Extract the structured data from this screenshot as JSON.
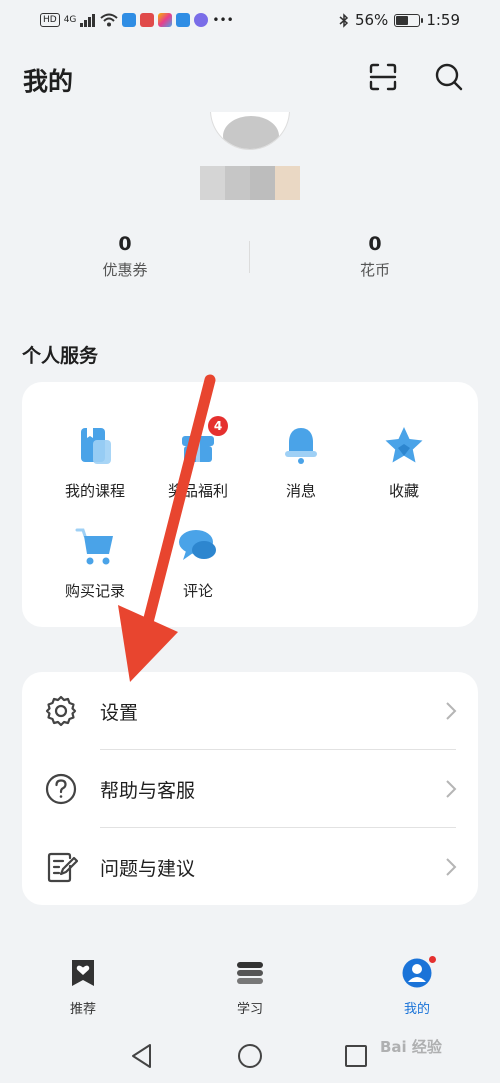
{
  "status_bar": {
    "left_icons": [
      "hd-icon",
      "signal-icon",
      "wifi-icon",
      "cloud-icon",
      "app-icon",
      "app-icon",
      "cloud-icon",
      "music-icon",
      "more-icon"
    ],
    "hd": "HD",
    "net": "4G",
    "battery_percent_text": "56%",
    "battery_level": 0.56,
    "time": "1:59"
  },
  "header": {
    "title": "我的",
    "scan_icon": "scan-icon",
    "search_icon": "search-icon"
  },
  "stats": [
    {
      "value": "0",
      "label": "优惠券"
    },
    {
      "value": "0",
      "label": "花币"
    }
  ],
  "services": {
    "title": "个人服务",
    "items": [
      {
        "label": "我的课程",
        "icon": "book-icon",
        "badge": ""
      },
      {
        "label": "奖品福利",
        "icon": "gift-icon",
        "badge": "4"
      },
      {
        "label": "消息",
        "icon": "bell-icon",
        "badge": ""
      },
      {
        "label": "收藏",
        "icon": "star-icon",
        "badge": ""
      },
      {
        "label": "购买记录",
        "icon": "cart-icon",
        "badge": ""
      },
      {
        "label": "评论",
        "icon": "comment-icon",
        "badge": ""
      }
    ]
  },
  "menu": [
    {
      "label": "设置",
      "icon": "gear-icon"
    },
    {
      "label": "帮助与客服",
      "icon": "help-icon"
    },
    {
      "label": "问题与建议",
      "icon": "feedback-icon"
    }
  ],
  "bottom_nav": [
    {
      "label": "推荐",
      "icon": "heart-bookmark-icon",
      "active": false
    },
    {
      "label": "学习",
      "icon": "layers-icon",
      "active": false
    },
    {
      "label": "我的",
      "icon": "user-icon",
      "active": true
    }
  ],
  "watermark": "Bai  经验",
  "colors": {
    "accent": "#1a73d8",
    "icon_blue": "#4aa3e8",
    "badge": "#e5302f",
    "arrow": "#e8452f"
  }
}
